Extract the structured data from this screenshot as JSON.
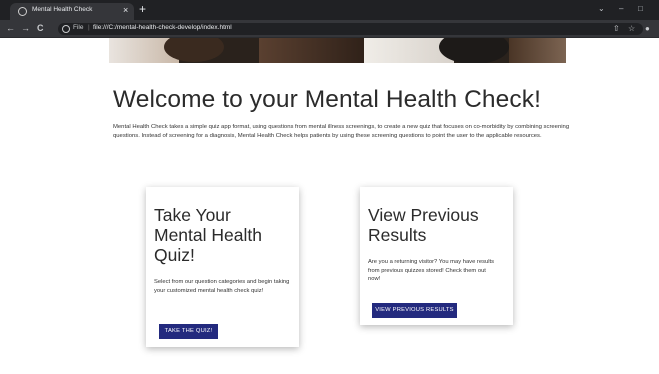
{
  "browser": {
    "tab_title": "Mental Health Check",
    "tab_close": "×",
    "new_tab": "+",
    "back": "←",
    "forward": "→",
    "reload": "C",
    "file_label": "File",
    "url_separator": "|",
    "url": "file:///C:/mental-health-check-develop/index.html",
    "share_icon": "⇧",
    "star_icon": "☆",
    "profile_icon": "●",
    "dropdown": "⌄",
    "minimize": "–",
    "maximize": "□"
  },
  "page": {
    "title": "Welcome to your Mental Health Check!",
    "intro": "Mental Health Check takes a simple quiz app format, using questions from mental illness screenings, to create a new quiz that focuses on co-morbidity by combining screening questions. Instead of screening for a diagnosis, Mental Health Check helps patients by using these screening questions to point the user to the applicable resources."
  },
  "cards": [
    {
      "title_lines": [
        "Take Your",
        "Mental Health",
        "Quiz!"
      ],
      "body": "Select from our question categories and begin taking your customized mental health check quiz!",
      "button": "TAKE THE QUIZ!"
    },
    {
      "title_lines": [
        "View Previous",
        "Results"
      ],
      "body": "Are you a returning visitor? You may have results from previous quizzes stored! Check them out now!",
      "button": "VIEW PREVIOUS RESULTS"
    }
  ]
}
